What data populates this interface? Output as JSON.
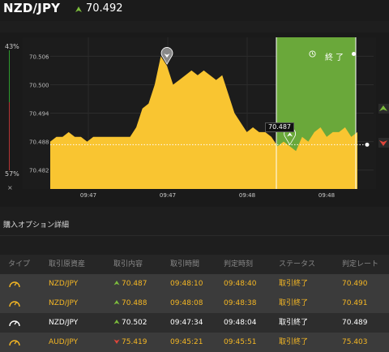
{
  "header": {
    "pair": "NZD/JPY",
    "price": "70.492",
    "direction_icon": "up-arrow-icon",
    "accent_green": "#7cbc3c"
  },
  "chart": {
    "expiry_label": "終了",
    "current_price_tag": "70.487",
    "gauge": {
      "top_pct": "43%",
      "bottom_pct": "57%"
    },
    "close_symbol": "×",
    "colors": {
      "area": "#f9c531",
      "expiry_zone": "#6aa83a",
      "marker_green": "#6aa83a",
      "marker_gray": "#888888"
    }
  },
  "chart_data": {
    "type": "area",
    "y_ticks": [
      "70.506",
      "70.500",
      "70.494",
      "70.488",
      "70.482"
    ],
    "ylim": [
      70.478,
      70.51
    ],
    "x_tick_labels": [
      "09:47",
      "09:47",
      "09:48",
      "09:48"
    ],
    "x": [
      0,
      2,
      4,
      6,
      8,
      10,
      12,
      14,
      16,
      18,
      20,
      22,
      24,
      26,
      28,
      30,
      32,
      34,
      36,
      38,
      40,
      42,
      44,
      46,
      48,
      50,
      52,
      54,
      56,
      58,
      60,
      62,
      64,
      66,
      68,
      70,
      72,
      74,
      76,
      78,
      80,
      82,
      84,
      86,
      88,
      90,
      92,
      94,
      96,
      98,
      100
    ],
    "values": [
      70.488,
      70.489,
      70.489,
      70.49,
      70.489,
      70.489,
      70.488,
      70.489,
      70.489,
      70.489,
      70.489,
      70.489,
      70.489,
      70.489,
      70.491,
      70.495,
      70.496,
      70.5,
      70.506,
      70.504,
      70.5,
      70.501,
      70.502,
      70.503,
      70.502,
      70.503,
      70.502,
      70.501,
      70.502,
      70.498,
      70.494,
      70.492,
      70.49,
      70.491,
      70.49,
      70.49,
      70.489,
      70.487,
      70.488,
      70.487,
      70.486,
      70.489,
      70.488,
      70.49,
      70.491,
      70.489,
      70.49,
      70.49,
      70.491,
      70.489,
      70.49
    ],
    "current_value": 70.487,
    "markers": [
      {
        "x": 38,
        "direction": "down",
        "color": "gray"
      },
      {
        "x": 78,
        "direction": "up",
        "color": "green"
      }
    ]
  },
  "section": {
    "title": "購入オプション詳細"
  },
  "table": {
    "headers": [
      "タイプ",
      "取引原資産",
      "取引内容",
      "取引時間",
      "判定時刻",
      "ステータス",
      "判定レート"
    ],
    "rows": [
      {
        "type_icon": "gauge-icon",
        "asset": "NZD/JPY",
        "dir": "up",
        "rate": "70.487",
        "time": "09:48:10",
        "judge": "09:48:40",
        "status": "取引終了",
        "result": "70.490",
        "style": "gold"
      },
      {
        "type_icon": "gauge-icon",
        "asset": "NZD/JPY",
        "dir": "up",
        "rate": "70.488",
        "time": "09:48:08",
        "judge": "09:48:38",
        "status": "取引終了",
        "result": "70.491",
        "style": "gold"
      },
      {
        "type_icon": "gauge-icon",
        "asset": "NZD/JPY",
        "dir": "up",
        "rate": "70.502",
        "time": "09:47:34",
        "judge": "09:48:04",
        "status": "取引終了",
        "result": "70.489",
        "style": "white"
      },
      {
        "type_icon": "gauge-icon",
        "asset": "AUD/JPY",
        "dir": "down",
        "rate": "75.419",
        "time": "09:45:21",
        "judge": "09:45:51",
        "status": "取引終了",
        "result": "75.403",
        "style": "gold"
      }
    ]
  }
}
